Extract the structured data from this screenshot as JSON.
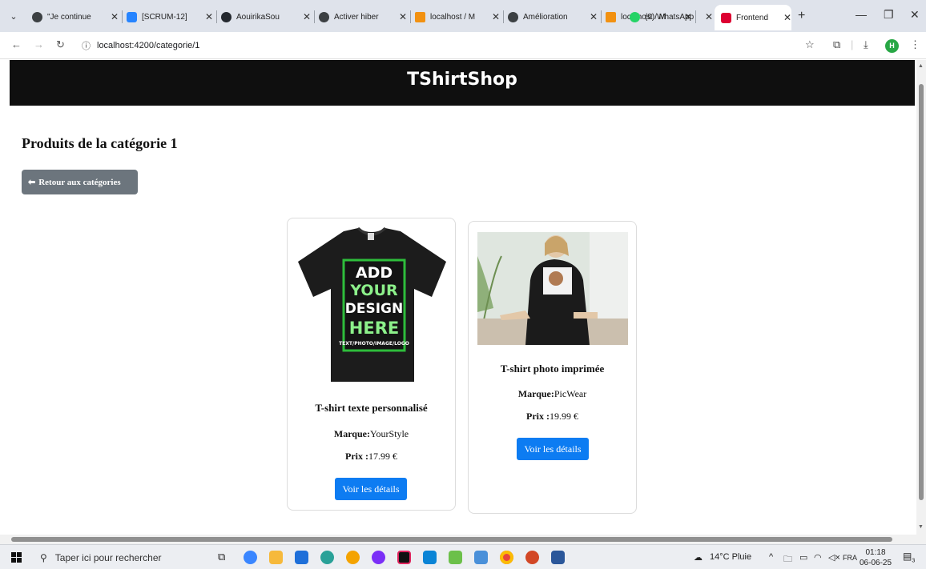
{
  "browser": {
    "tabs": [
      {
        "label": "\"Je continue",
        "active": false,
        "favicon_color": "#3c4043"
      },
      {
        "label": "[SCRUM-12]",
        "active": false,
        "favicon_color": "#2684ff"
      },
      {
        "label": "AouirikaSou",
        "active": false,
        "favicon_color": "#24292f"
      },
      {
        "label": "Activer hiber",
        "active": false,
        "favicon_color": "#3c4043"
      },
      {
        "label": "localhost / M",
        "active": false,
        "favicon_color": "#f29111"
      },
      {
        "label": "Amélioration",
        "active": false,
        "favicon_color": "#3c4043"
      },
      {
        "label": "localhost / M",
        "active": false,
        "favicon_color": "#f29111"
      },
      {
        "label": "(9) WhatsApp",
        "active": false,
        "favicon_color": "#25d366"
      },
      {
        "label": "Frontend",
        "active": true,
        "favicon_color": "#dd0031"
      }
    ],
    "new_tab": "+",
    "url": "localhost:4200/categorie/1",
    "profile_initial": "H"
  },
  "site": {
    "brand": "TShirtShop",
    "page_title": "Produits de la catégorie 1",
    "back_button": "Retour aux catégories",
    "products": [
      {
        "name": "T-shirt texte personnalisé",
        "brand_label": "Marque:",
        "brand": "YourStyle",
        "price_label": "Prix :",
        "price": "17.99 €",
        "button": "Voir les détails",
        "image_text": [
          "ADD",
          "YOUR",
          "DESIGN",
          "HERE",
          "TEXT/PHOTO/IMAGE/LOGO"
        ]
      },
      {
        "name": "T-shirt photo imprimée",
        "brand_label": "Marque:",
        "brand": "PicWear",
        "price_label": "Prix :",
        "price": "19.99 €",
        "button": "Voir les détails"
      }
    ]
  },
  "taskbar": {
    "search_placeholder": "Taper ici pour rechercher",
    "weather": "14°C Pluie",
    "language": "FRA",
    "time": "01:18",
    "date": "06-06-25",
    "notification_count": "3"
  },
  "colors": {
    "header_bg": "#0f0f0f",
    "primary_button": "#0d7cf2",
    "secondary_button": "#6c757d"
  }
}
